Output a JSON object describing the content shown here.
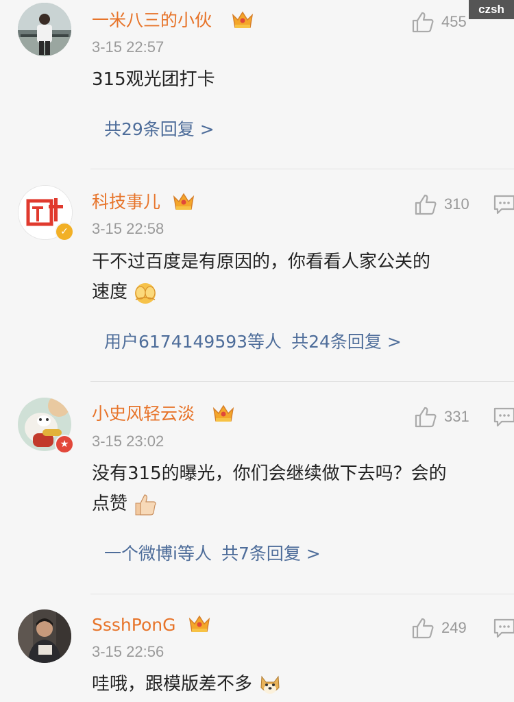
{
  "watermark": "czsh",
  "comments": [
    {
      "username": "一米八三的小伙",
      "time": "3-15 22:57",
      "likes": "455",
      "lines": [
        "315观光团打卡"
      ],
      "reply_users": "",
      "reply_count": "共29条回复 >"
    },
    {
      "username": "科技事儿",
      "time": "3-15 22:58",
      "likes": "310",
      "lines": [
        "干不过百度是有原因的，你看看人家公关的",
        "速度"
      ],
      "reply_users": "用户6174149593等人",
      "reply_count": "共24条回复 >",
      "emoji": "pleading-face-emoji"
    },
    {
      "username": "小史风轻云淡",
      "time": "3-15 23:02",
      "likes": "331",
      "lines": [
        "没有315的曝光，你们会继续做下去吗？会的",
        "点赞"
      ],
      "reply_users": "一个微博i等人",
      "reply_count": "共7条回复 >",
      "emoji": "thumbs-up-emoji"
    },
    {
      "username": "SsshPonG",
      "time": "3-15 22:56",
      "likes": "249",
      "lines": [
        "哇哦，跟模版差不多"
      ],
      "emoji": "doge-emoji"
    }
  ],
  "icons": {
    "like": "thumbs-up-outline-icon",
    "reply": "comment-bubble-icon",
    "member": "crown-icon"
  },
  "colors": {
    "username": "#e7742a",
    "link": "#4e6d9a",
    "meta": "#999999",
    "background": "#f6f6f6"
  }
}
